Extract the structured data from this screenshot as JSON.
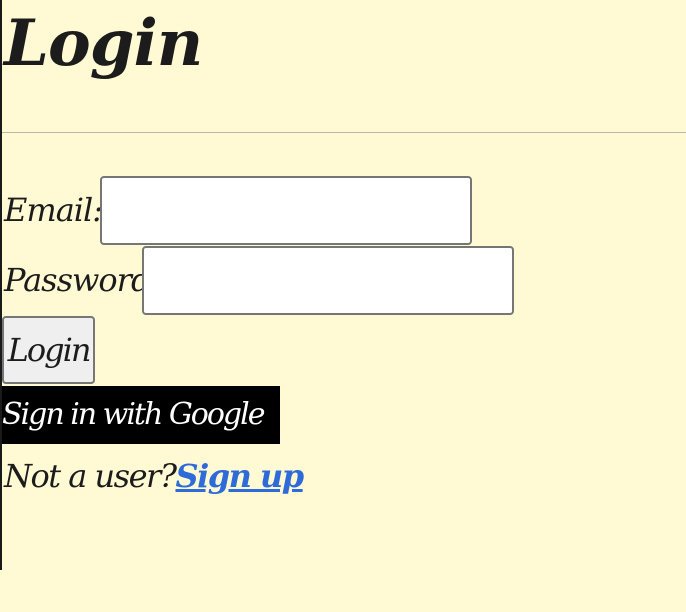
{
  "page": {
    "title": "Login"
  },
  "form": {
    "email_label": "Email:",
    "email_value": "",
    "password_label": "Password:",
    "password_value": "",
    "login_button": "Login",
    "google_button": "Sign in with Google"
  },
  "signup": {
    "prompt": "Not a user?",
    "link_text": "Sign up"
  },
  "colors": {
    "background": "#fffad4",
    "text": "#1c1c1c",
    "google_button_bg": "#000000",
    "link": "#2e6ad8"
  }
}
